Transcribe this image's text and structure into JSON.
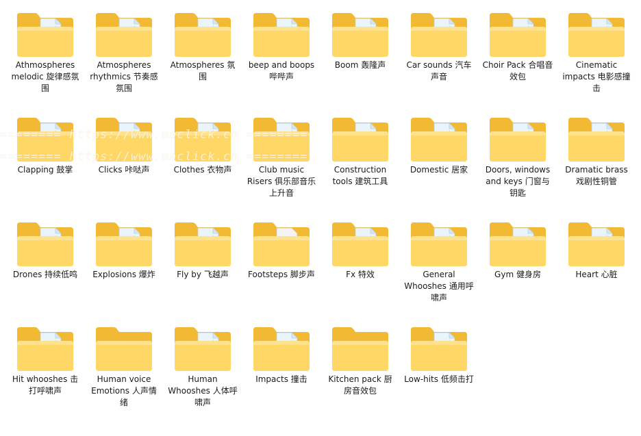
{
  "window": {
    "view": "large-icons"
  },
  "watermark_text": "======== https://www.maclick.cn ========",
  "colors": {
    "folder_back": "#f2b934",
    "folder_front": "#ffd766",
    "document": "#eaf4fb",
    "music_note": "#57a8d8",
    "audio_app_green": "#2e9e3e"
  },
  "folders": [
    {
      "label": "Athmospheres melodic 旋律感氛围",
      "content": "doc"
    },
    {
      "label": "Atmospheres rhythmics 节奏感氛围",
      "content": "doc"
    },
    {
      "label": "Atmospheres 氛围",
      "content": "doc"
    },
    {
      "label": "beep and boops 哔哔声",
      "content": "doc"
    },
    {
      "label": "Boom 轰隆声",
      "content": "doc"
    },
    {
      "label": "Car sounds 汽车声音",
      "content": "doc"
    },
    {
      "label": "Choir Pack 合唱音效包",
      "content": "doc"
    },
    {
      "label": "Cinematic impacts 电影感撞击",
      "content": "doc"
    },
    {
      "label": "Clapping 鼓掌",
      "content": "doc"
    },
    {
      "label": "Clicks 咔哒声",
      "content": "doc"
    },
    {
      "label": "Clothes 衣物声",
      "content": "doc"
    },
    {
      "label": "Club music Risers 俱乐部音乐上升音",
      "content": "doc"
    },
    {
      "label": "Construction tools 建筑工具",
      "content": "doc"
    },
    {
      "label": "Domestic 居家",
      "content": "doc"
    },
    {
      "label": "Doors, windows and keys 门窗与钥匙",
      "content": "doc"
    },
    {
      "label": "Dramatic brass 戏剧性铜管",
      "content": "doc"
    },
    {
      "label": "Drones 持续低鸣",
      "content": "doc"
    },
    {
      "label": "Explosions 爆炸",
      "content": "doc"
    },
    {
      "label": "Fly by 飞越声",
      "content": "doc"
    },
    {
      "label": "Footsteps 脚步声",
      "content": "app"
    },
    {
      "label": "Fx 特效",
      "content": "doc"
    },
    {
      "label": "General Whooshes 通用呼啸声",
      "content": "doc"
    },
    {
      "label": "Gym 健身房",
      "content": "doc"
    },
    {
      "label": "Heart 心脏",
      "content": "doc"
    },
    {
      "label": "Hit whooshes 击打呼啸声",
      "content": "doc"
    },
    {
      "label": "Human voice Emotions 人声情绪",
      "content": "empty"
    },
    {
      "label": "Human Whooshes 人体呼啸声",
      "content": "doc"
    },
    {
      "label": "Impacts 撞击",
      "content": "doc"
    },
    {
      "label": "Kitchen pack 厨房音效包",
      "content": "empty"
    },
    {
      "label": "Low-hits 低频击打",
      "content": "doc"
    }
  ]
}
